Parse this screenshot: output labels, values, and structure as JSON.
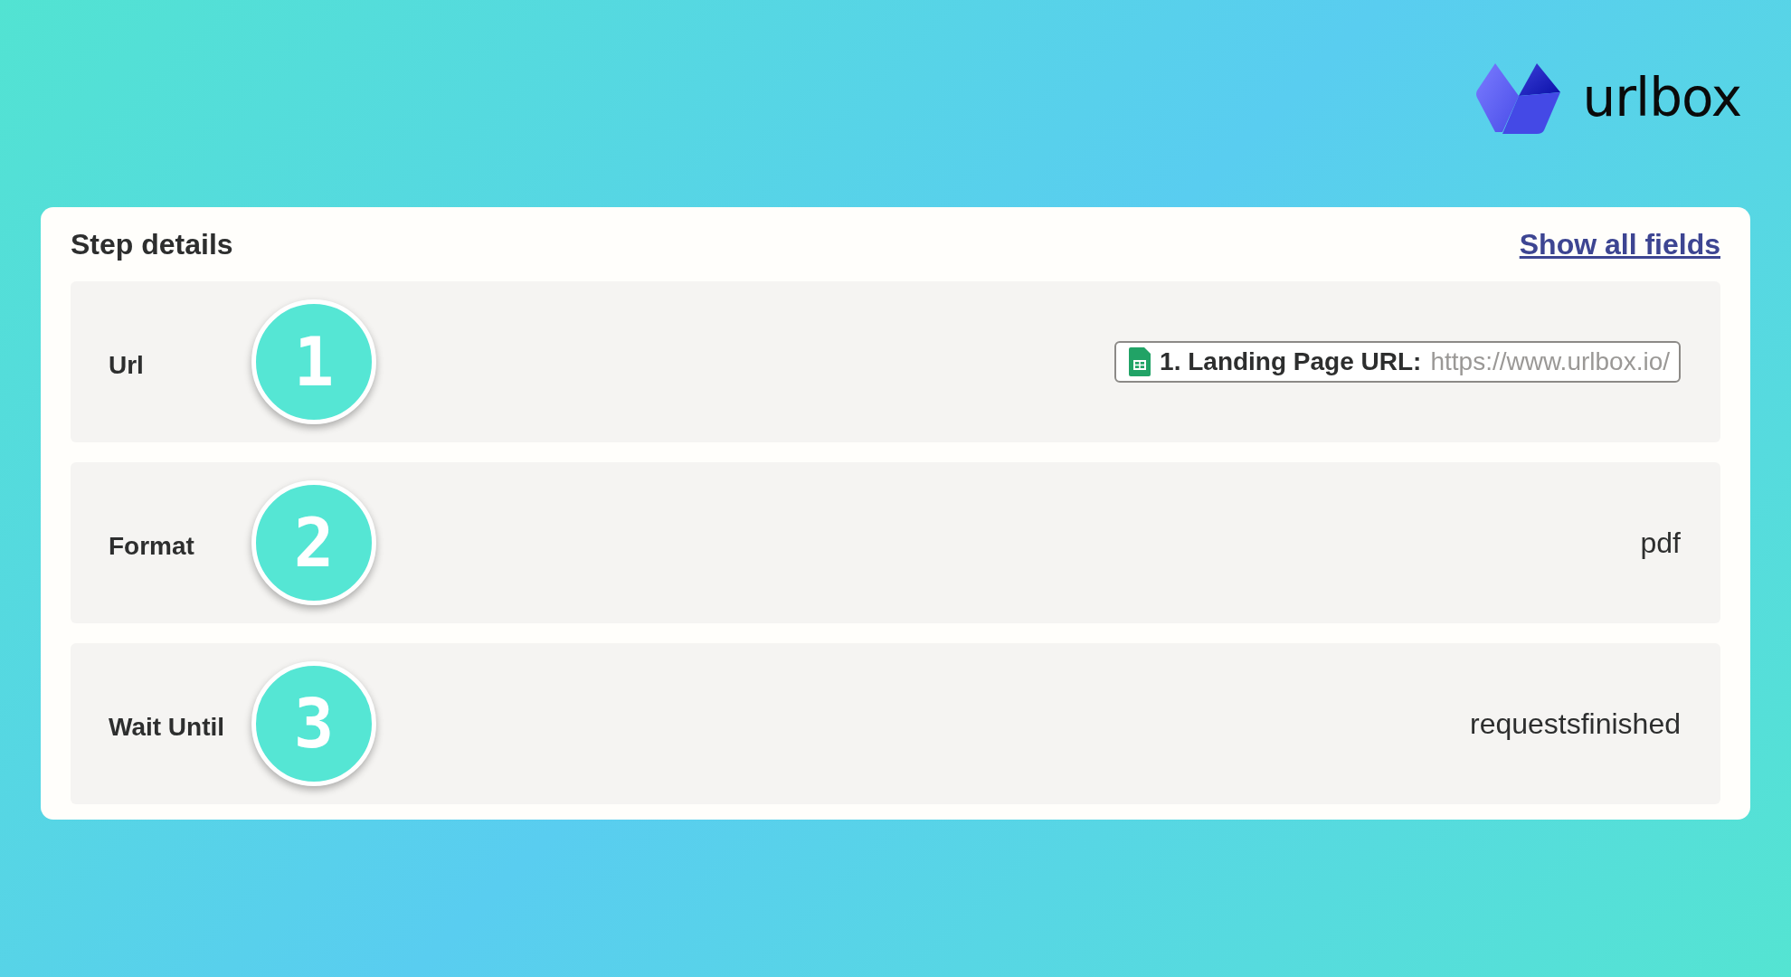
{
  "logo": {
    "text": "urlbox"
  },
  "card": {
    "title": "Step details",
    "link": "Show all fields",
    "rows": [
      {
        "label": "Url",
        "step": "1",
        "kind": "chip",
        "chip_label": "1. Landing Page URL:",
        "value": "https://www.urlbox.io/"
      },
      {
        "label": "Format",
        "step": "2",
        "kind": "plain",
        "value": "pdf"
      },
      {
        "label": "Wait Until",
        "step": "3",
        "kind": "plain",
        "value": "requestsfinished"
      }
    ]
  }
}
